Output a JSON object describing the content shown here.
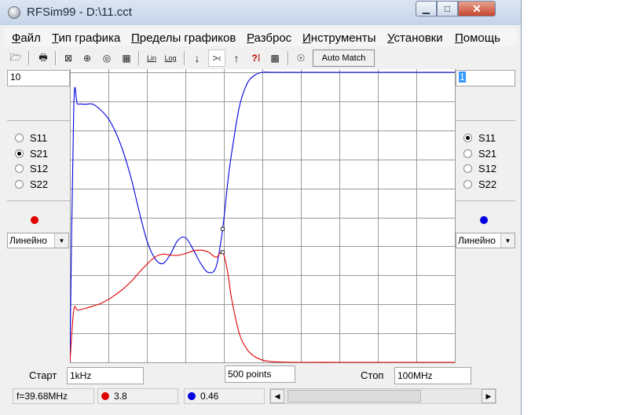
{
  "window": {
    "title": "RFSim99 - D:\\11.cct",
    "min_glyph": "▁",
    "max_glyph": "□",
    "close_glyph": "✕"
  },
  "menu": [
    "Файл",
    "Тип графика",
    "Пределы графиков",
    "Разброс",
    "Инструменты",
    "Установки",
    "Помощь"
  ],
  "toolbar": {
    "buttons": [
      {
        "name": "open-icon",
        "glyph": "🗁"
      },
      {
        "name": "print-icon",
        "glyph": "🖶"
      },
      {
        "name": "rect-plot-icon",
        "glyph": "⊠"
      },
      {
        "name": "smith-chart-icon",
        "glyph": "⊕"
      },
      {
        "name": "polar-plot-icon",
        "glyph": "◎"
      },
      {
        "name": "table-icon",
        "glyph": "▦"
      },
      {
        "name": "lin-scale-icon",
        "glyph": "Lin"
      },
      {
        "name": "log-scale-icon",
        "glyph": "Log"
      },
      {
        "name": "arrow-down-icon",
        "glyph": "↓"
      },
      {
        "name": "marker-center-icon",
        "glyph": ">‹"
      },
      {
        "name": "arrow-up-icon",
        "glyph": "↑"
      },
      {
        "name": "help-icon",
        "glyph": "?⁞"
      },
      {
        "name": "component-icon",
        "glyph": "▩"
      },
      {
        "name": "tune-icon",
        "glyph": "☉"
      }
    ],
    "auto_match_label": "Auto Match"
  },
  "left_panel": {
    "top_value": "10",
    "options": [
      "S11",
      "S21",
      "S12",
      "S22"
    ],
    "selected": "S21",
    "trace_color": "#e00000",
    "scale_select": "Линейно"
  },
  "right_panel": {
    "top_value": "1",
    "options": [
      "S11",
      "S21",
      "S12",
      "S22"
    ],
    "selected": "S11",
    "trace_color": "#0000e0",
    "scale_select": "Линейно"
  },
  "bottom": {
    "start_label": "Старт",
    "start_value": "1kHz",
    "points_value": "500 points",
    "stop_label": "Стоп",
    "stop_value": "100MHz"
  },
  "status": {
    "frequency": "f=39.68MHz",
    "red_value": "3.8",
    "red_color": "#e00000",
    "blue_value": "0.46",
    "blue_color": "#0000e0"
  },
  "chart_data": {
    "type": "line",
    "grid": true,
    "grid_divisions": {
      "x": 10,
      "y": 10
    },
    "xlim": [
      0,
      100
    ],
    "left_axis": {
      "max": 10,
      "scale": "linear"
    },
    "right_axis": {
      "max": 1,
      "scale": "linear"
    },
    "x": [
      0,
      1,
      2,
      4,
      6,
      8,
      10,
      12,
      14,
      16,
      18,
      20,
      22,
      24,
      26,
      28,
      30,
      32,
      34,
      36,
      38,
      39.68,
      41,
      42,
      44,
      46,
      48,
      50,
      52,
      55,
      60,
      70,
      80,
      90,
      100
    ],
    "series": [
      {
        "axis": "right",
        "color": "#0000e0",
        "values": [
          0.0,
          0.88,
          0.89,
          0.89,
          0.89,
          0.87,
          0.84,
          0.79,
          0.72,
          0.63,
          0.52,
          0.42,
          0.36,
          0.34,
          0.37,
          0.42,
          0.43,
          0.39,
          0.34,
          0.31,
          0.33,
          0.46,
          0.62,
          0.72,
          0.88,
          0.96,
          0.99,
          1.0,
          1.0,
          1.0,
          1.0,
          1.0,
          1.0,
          1.0,
          1.0
        ]
      },
      {
        "axis": "left",
        "color": "#e00000",
        "values": [
          0.0,
          1.8,
          1.8,
          1.86,
          1.94,
          2.03,
          2.17,
          2.35,
          2.55,
          2.8,
          3.1,
          3.38,
          3.62,
          3.73,
          3.7,
          3.69,
          3.75,
          3.84,
          3.87,
          3.8,
          3.62,
          3.8,
          3.1,
          2.2,
          1.0,
          0.45,
          0.2,
          0.08,
          0.03,
          0.01,
          0.0,
          0.0,
          0.0,
          0.0,
          0.0
        ]
      }
    ],
    "markers": [
      {
        "series": 0,
        "x": 39.68,
        "value": 0.46
      },
      {
        "series": 1,
        "x": 39.68,
        "value": 3.8
      }
    ]
  }
}
